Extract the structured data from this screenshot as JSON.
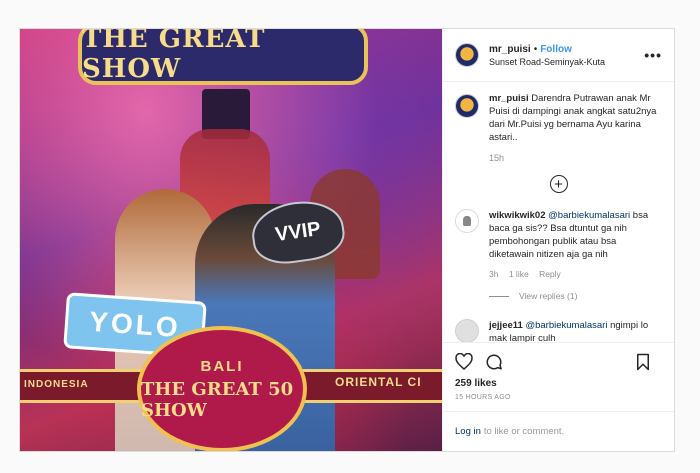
{
  "post": {
    "username": "mr_puisi",
    "follow_label": "Follow",
    "location": "Sunset Road-Seminyak-Kuta",
    "more_label": "•••",
    "caption": {
      "username": "mr_puisi",
      "text": "Darendra Putrawan anak Mr Puisi di dampingi anak angkat satu2nya dari Mr.Puisi yg bernama Ayu karina astari..",
      "time": "15h"
    },
    "comments": [
      {
        "username": "wikwikwik02",
        "mention": "@barbiekumalasari",
        "text": "bsa baca ga sis?? Bsa dtuntut ga nih pembohongan publik atau bsa diketawain nitizen aja ga nih",
        "time": "3h",
        "likes": "1 like",
        "reply_label": "Reply",
        "view_replies": "View replies (1)"
      },
      {
        "username": "jejjee11",
        "mention": "@barbiekumalasari",
        "text": "ngimpi lo mak lampir culh"
      }
    ],
    "likes": "259 likes",
    "time_ago": "15 HOURS AGO",
    "login_link": "Log in",
    "login_text": "to like or comment."
  },
  "photo": {
    "banner_top": "THE GREAT SHOW",
    "vvip": "VVIP",
    "yolo": "YOLO",
    "strip_left": "INDONESIA",
    "strip_right": "ORIENTAL CI",
    "badge_line1": "BALI",
    "badge_line2": "THE GREAT 50 SHOW"
  },
  "colors": {
    "accent": "#3897f0",
    "link": "#003569",
    "muted": "#8e8e8e"
  }
}
